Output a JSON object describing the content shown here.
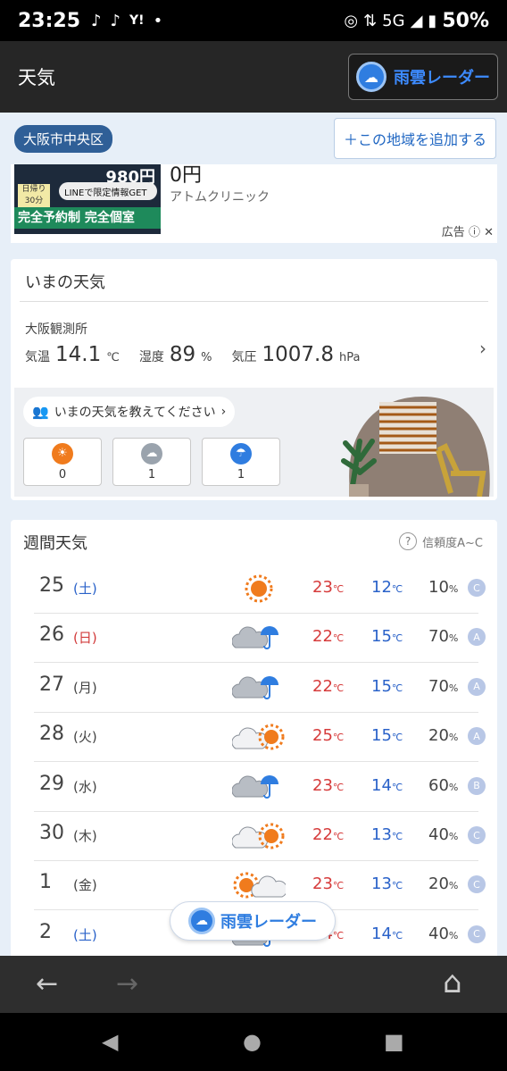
{
  "status": {
    "time": "23:25",
    "icons": [
      "♪",
      "♪",
      "Y!",
      "•"
    ],
    "network": "5G",
    "battery": "50%"
  },
  "header": {
    "title": "天気",
    "radar_label": "雨雲レーダー"
  },
  "location": {
    "name": "大阪市中央区",
    "add_label": "＋この地域を追加する"
  },
  "ad": {
    "headline": "0円",
    "sponsor": "アトムクリニック",
    "label": "広告",
    "image_texts": {
      "price": "980円",
      "line": "LINEで限定情報GET",
      "duration": "日帰り 30分",
      "banner": "完全予約制 完全個室"
    }
  },
  "current": {
    "title": "いまの天気",
    "station": "大阪観測所",
    "temp_label": "気温",
    "temp": "14.1",
    "temp_unit": "℃",
    "humidity_label": "湿度",
    "humidity": "89",
    "humidity_unit": "%",
    "pressure_label": "気圧",
    "pressure": "1007.8",
    "pressure_unit": "hPa",
    "ask": "いまの天気を教えてください",
    "votes": [
      {
        "icon": "sun-icon",
        "count": "0",
        "color": "#f07b1d"
      },
      {
        "icon": "cloud-icon",
        "count": "1",
        "color": "#9aa3ad"
      },
      {
        "icon": "umbrella-icon",
        "count": "1",
        "color": "#2f7de0"
      }
    ]
  },
  "weekly": {
    "title": "週間天気",
    "reliability": "信頼度A~C",
    "temp_unit": "℃",
    "pct_unit": "%",
    "days": [
      {
        "day": "25",
        "weekday": "(土)",
        "kind": "sat",
        "icon": "sunny",
        "hi": "23",
        "lo": "12",
        "pop": "10",
        "grade": "C"
      },
      {
        "day": "26",
        "weekday": "(日)",
        "kind": "sun",
        "icon": "cloud-rain",
        "hi": "22",
        "lo": "15",
        "pop": "70",
        "grade": "A"
      },
      {
        "day": "27",
        "weekday": "(月)",
        "kind": "",
        "icon": "cloud-rain",
        "hi": "22",
        "lo": "15",
        "pop": "70",
        "grade": "A"
      },
      {
        "day": "28",
        "weekday": "(火)",
        "kind": "",
        "icon": "cloud-sun",
        "hi": "25",
        "lo": "15",
        "pop": "20",
        "grade": "A"
      },
      {
        "day": "29",
        "weekday": "(水)",
        "kind": "",
        "icon": "cloud-rain",
        "hi": "23",
        "lo": "14",
        "pop": "60",
        "grade": "B"
      },
      {
        "day": "30",
        "weekday": "(木)",
        "kind": "",
        "icon": "cloud-sun",
        "hi": "22",
        "lo": "13",
        "pop": "40",
        "grade": "C"
      },
      {
        "day": "1",
        "weekday": "(金)",
        "kind": "",
        "icon": "sun-cloud",
        "hi": "23",
        "lo": "13",
        "pop": "20",
        "grade": "C"
      },
      {
        "day": "2",
        "weekday": "(土)",
        "kind": "sat",
        "icon": "cloud-rain",
        "hi": "24",
        "lo": "14",
        "pop": "40",
        "grade": "C"
      }
    ]
  },
  "floating_radar": "雨雲レーダー",
  "browser_nav": {
    "back": "←",
    "forward": "→",
    "home": "⌂"
  },
  "system_nav": {
    "back": "◀",
    "home": "●",
    "recents": "■"
  },
  "colors": {
    "accent": "#2f7de0",
    "hi_temp": "#d63b3b",
    "lo_temp": "#2a62c9",
    "location_badge": "#2f5f97"
  }
}
